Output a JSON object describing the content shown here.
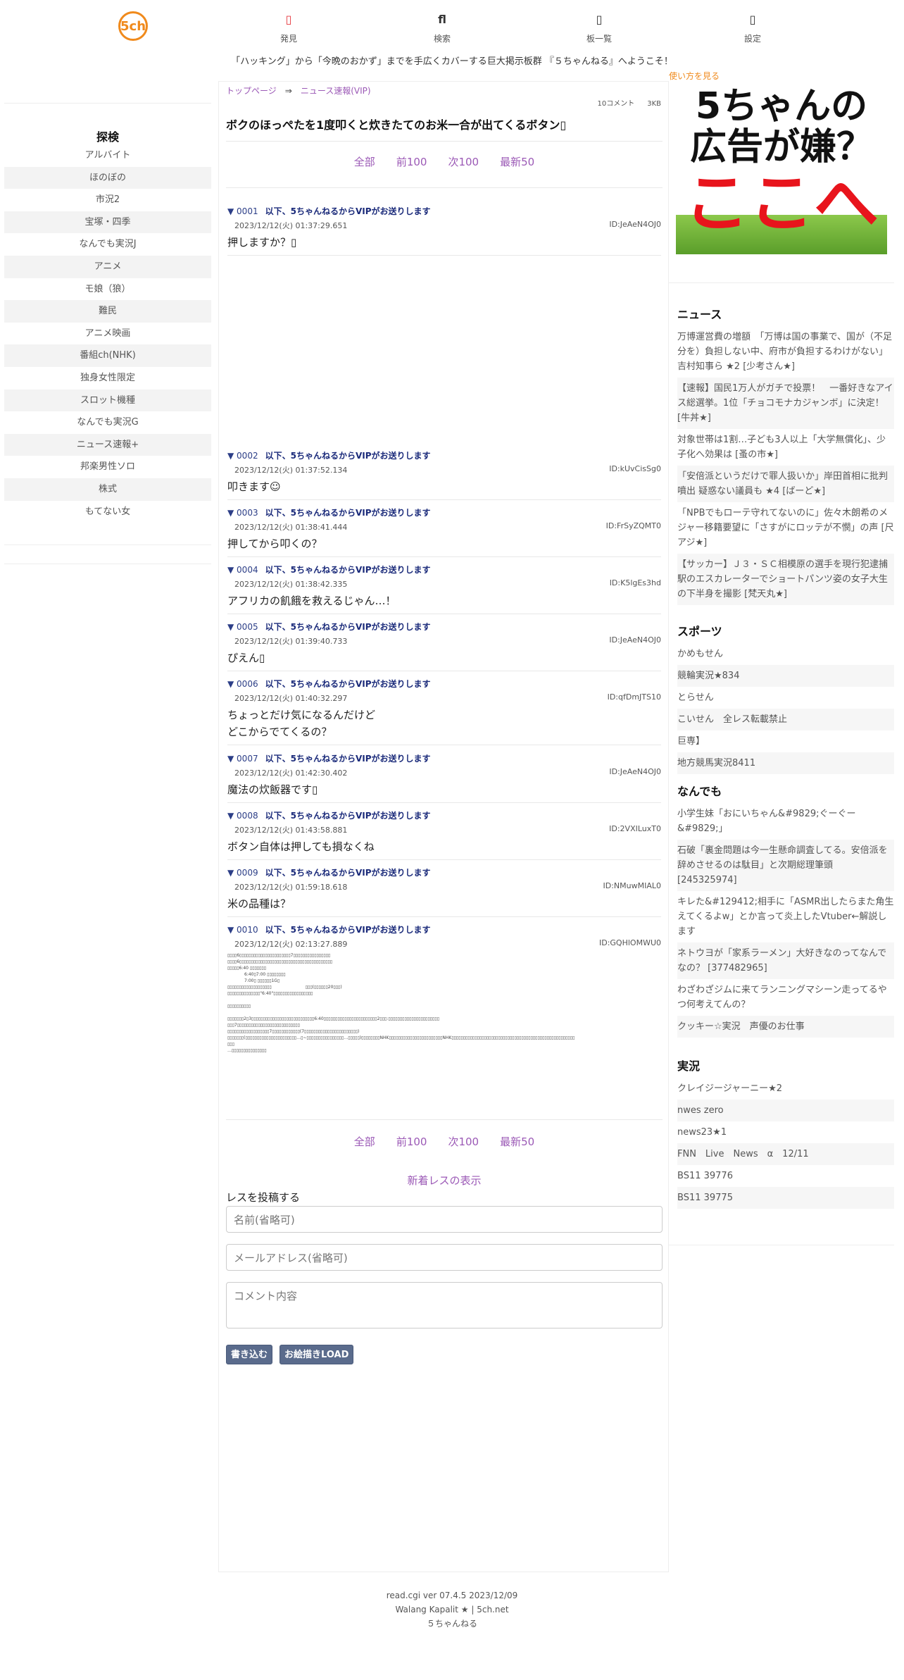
{
  "header": {
    "logo_text": "5ch",
    "nav": [
      {
        "icon": "lightbulb-icon",
        "glyph": "▯",
        "label": "発見"
      },
      {
        "icon": "search-icon",
        "glyph": "ﬂ",
        "label": "検索"
      },
      {
        "icon": "list-icon",
        "glyph": "▯",
        "label": "板一覧"
      },
      {
        "icon": "gear-icon",
        "glyph": "▯",
        "label": "設定"
      }
    ],
    "welcome": "「ハッキング」から「今晩のおかず」までを手広くカバーする巨大掲示板群 『５ちゃんねる』へようこそ！"
  },
  "sidebar": {
    "title": "探検",
    "items": [
      "アルバイト",
      "ほのぼの",
      "市況2",
      "宝塚・四季",
      "なんでも実況J",
      "アニメ",
      "モ娘（狼）",
      "難民",
      "アニメ映画",
      "番組ch(NHK)",
      "独身女性限定",
      "スロット機種",
      "なんでも実況G",
      "ニュース速報+",
      "邦楽男性ソロ",
      "株式",
      "もてない女"
    ]
  },
  "main": {
    "breadcrumb": {
      "home": "トップページ",
      "arrow": "⇒",
      "board": "ニュース速報(VIP)"
    },
    "comments": "10コメント",
    "size": "3KB",
    "title": "ボクのほっぺたを1度叩くと炊きたてのお米一合が出てくるボタン▯",
    "pager": {
      "all": "全部",
      "prev": "前100",
      "next": "次100",
      "latest": "最新50"
    },
    "posts": [
      {
        "num": "0001",
        "name": "以下、5ちゃんねるからVIPがお送りします",
        "date": "2023/12/12(火) 01:37:29.651",
        "id": "ID:JeAeN4OJ0",
        "body": "押しますか？▯"
      },
      {
        "num": "0002",
        "name": "以下、5ちゃんねるからVIPがお送りします",
        "date": "2023/12/12(火) 01:37:52.134",
        "id": "ID:kUvCisSg0",
        "body": "叩きます☺"
      },
      {
        "num": "0003",
        "name": "以下、5ちゃんねるからVIPがお送りします",
        "date": "2023/12/12(火) 01:38:41.444",
        "id": "ID:FrSyZQMT0",
        "body": "押してから叩くの？"
      },
      {
        "num": "0004",
        "name": "以下、5ちゃんねるからVIPがお送りします",
        "date": "2023/12/12(火) 01:38:42.335",
        "id": "ID:K5lgEs3hd",
        "body": "アフリカの飢餓を救えるじゃん…！"
      },
      {
        "num": "0005",
        "name": "以下、5ちゃんねるからVIPがお送りします",
        "date": "2023/12/12(火) 01:39:40.733",
        "id": "ID:JeAeN4OJ0",
        "body": "ぴえん▯"
      },
      {
        "num": "0006",
        "name": "以下、5ちゃんねるからVIPがお送りします",
        "date": "2023/12/12(火) 01:40:32.297",
        "id": "ID:qfDmJTS10",
        "body": "ちょっとだけ気になるんだけど",
        "body2": "どこからでてくるの？"
      },
      {
        "num": "0007",
        "name": "以下、5ちゃんねるからVIPがお送りします",
        "date": "2023/12/12(火) 01:42:30.402",
        "id": "ID:JeAeN4OJ0",
        "body": "魔法の炊飯器です▯"
      },
      {
        "num": "0008",
        "name": "以下、5ちゃんねるからVIPがお送りします",
        "date": "2023/12/12(火) 01:43:58.881",
        "id": "ID:2VXILuxT0",
        "body": "ボタン自体は押しても損なくね"
      },
      {
        "num": "0009",
        "name": "以下、5ちゃんねるからVIPがお送りします",
        "date": "2023/12/12(火) 01:59:18.618",
        "id": "ID:NMuwMIAL0",
        "body": "米の品種は？"
      },
      {
        "num": "0010",
        "name": "以下、5ちゃんねるからVIPがお送りします",
        "date": "2023/12/12(火) 02:13:27.889",
        "id": "ID:GQHlOMWU0"
      }
    ],
    "post10_lines": [
      "▯▯▯▯6▯▯▯▯▯▯▯▯▯▯▯▯▯▯▯▯▯▯▯▯▯▯7▯▯▯▯▯▯▯▯▯▯▯▯▯▯▯▯",
      "▯▯▯▯6▯▯▯▯▯▯▯▯▯▯▯▯▯▯▯▯▯▯▯▯▯▯▯▯▯▯▯▯▯▯▯▯▯▯▯▯▯▯▯▯",
      "▯▯▯▯▯6:40 ▯▯▯▯▯▯▯",
      "　　　　6:40▯7:00 ▯▯▯▯▯▯▯▯",
      "　　　　7:00▯ ▯▯▯▯▯▯1G▯",
      "▯▯▯▯▯▯▯▯▯▯▯▯▯▯▯▯▯▯▯　　　　　　　　▯▯▯(▯▯▯▯▯▯20▯▯▯)",
      "▯▯▯▯▯▯▯▯▯▯▯▯▯▯\"6:40\"▯▯▯▯▯▯▯▯▯▯▯▯▯▯▯▯▯",
      "",
      "▯▯▯▯▯▯▯▯▯▯",
      "",
      "▯▯▯▯▯▯▯2▯3▯▯▯▯▯▯▯▯▯▯▯▯▯▯▯▯▯▯▯▯▯▯▯▯▯▯▯6:40▯▯▯▯▯▯▯▯▯▯▯▯▯▯▯▯▯▯▯▯▯▯▯2▯▯▯:▯▯▯▯▯▯▯▯▯▯▯▯▯▯▯▯▯▯▯▯▯▯",
      "▯▯▯7▯▯▯▯▯▯▯▯▯▯▯▯▯▯▯▯▯▯▯▯▯▯▯▯▯▯▯",
      "▯▯▯▯▯▯▯▯▯▯▯▯▯▯▯▯▯▯7▯▯▯▯▯▯▯▯▯▯▯▯(7▯▯▯▯▯▯▯▯▯▯▯▯▯▯▯▯▯▯▯▯▯▯▯)",
      "▯▯▯▯▯▯▯(▯▯▯▯▯▯▯▯▯▯▯▯▯▯▯▯▯▯▯▯▯▯…▯~▯▯▯▯▯▯▯▯▯▯▯▯▯▯▯▯…▯▯▯▯▯)▯▯▯▯▯▯▯▯NHK▯▯▯▯▯▯▯▯▯▯▯▯▯▯▯▯▯▯▯▯▯▯▯NHK▯▯▯▯▯▯▯▯▯▯▯▯▯▯▯▯▯▯▯▯▯▯▯▯▯▯▯▯▯▯▯▯▯▯▯▯▯▯▯▯▯▯▯▯▯▯▯▯▯▯▯▯▯",
      "▯▯▯",
      "…▯▯▯▯▯▯▯▯▯▯▯▯▯▯▯"
    ],
    "new_res": "新着レスの表示",
    "form": {
      "title": "レスを投稿する",
      "name_placeholder": "名前(省略可)",
      "mail_placeholder": "メールアドレス(省略可)",
      "comment_placeholder": "コメント内容",
      "submit": "書き込む",
      "oekaki": "お絵描きLOAD"
    }
  },
  "right": {
    "howto": "使い方を見る",
    "ad": {
      "line1": "5ちゃんの",
      "line2": "広告が嫌？",
      "line3": "ここへ"
    },
    "sections": [
      {
        "title": "ニュース",
        "items": [
          "万博運営費の増額　「万博は国の事業で、国が（不足分を）負担しない中、府市が負担するわけがない」　吉村知事ら ★2 [少考さん★]",
          "【速報】国民1万人がガチで投票！　一番好きなアイス総選挙。1位「チョコモナカジャンボ」に決定！ [牛丼★]",
          "対象世帯は1割…子ども3人以上「大学無償化」、少子化へ効果は [蚤の市★]",
          "「安倍派というだけで罪人扱いか」岸田首相に批判噴出 疑惑ない議員も ★4 [ばーど★]",
          "「NPBでもローテ守れてないのに」佐々木朗希のメジャー移籍要望に「さすがにロッテが不憫」の声 [尺アジ★]",
          "【サッカー】Ｊ３・ＳＣ相模原の選手を現行犯逮捕　駅のエスカレーターでショートパンツ姿の女子大生の下半身を撮影 [梵天丸★]"
        ]
      },
      {
        "title": "スポーツ",
        "items": [
          "かめもせん",
          "競輪実況★834",
          "とらせん",
          "こいせん　全レス転載禁止",
          "巨専】",
          "地方競馬実況8411"
        ]
      },
      {
        "title": "なんでも",
        "items": [
          "小学生妹「おにいちゃん&#9829;ぐーぐー&#9829;」",
          "石破「裏金問題は今一生懸命調査してる。安倍派を辞めさせるのは駄目」と次期総理筆頭 [245325974]",
          "キレた&#129412;相手に「ASMR出したらまた角生えてくるよw」とか言って炎上したVtuber←解説します",
          "ネトウヨが「家系ラーメン」大好きなのってなんでなの？ [377482965]",
          "わざわざジムに来てランニングマシーン走ってるやつ何考えてんの？",
          "クッキー☆実況　声優のお仕事"
        ]
      },
      {
        "title": "実況",
        "items": [
          "クレイジージャーニー★2",
          "nwes zero",
          "news23★1",
          "FNN　Live　News　α　12/11",
          "BS11 39776",
          "BS11 39775"
        ]
      }
    ]
  },
  "footer": {
    "line1": "read.cgi ver 07.4.5 2023/12/09",
    "line2": "Walang Kapalit ★ | 5ch.net",
    "line3": "５ちゃんねる"
  }
}
